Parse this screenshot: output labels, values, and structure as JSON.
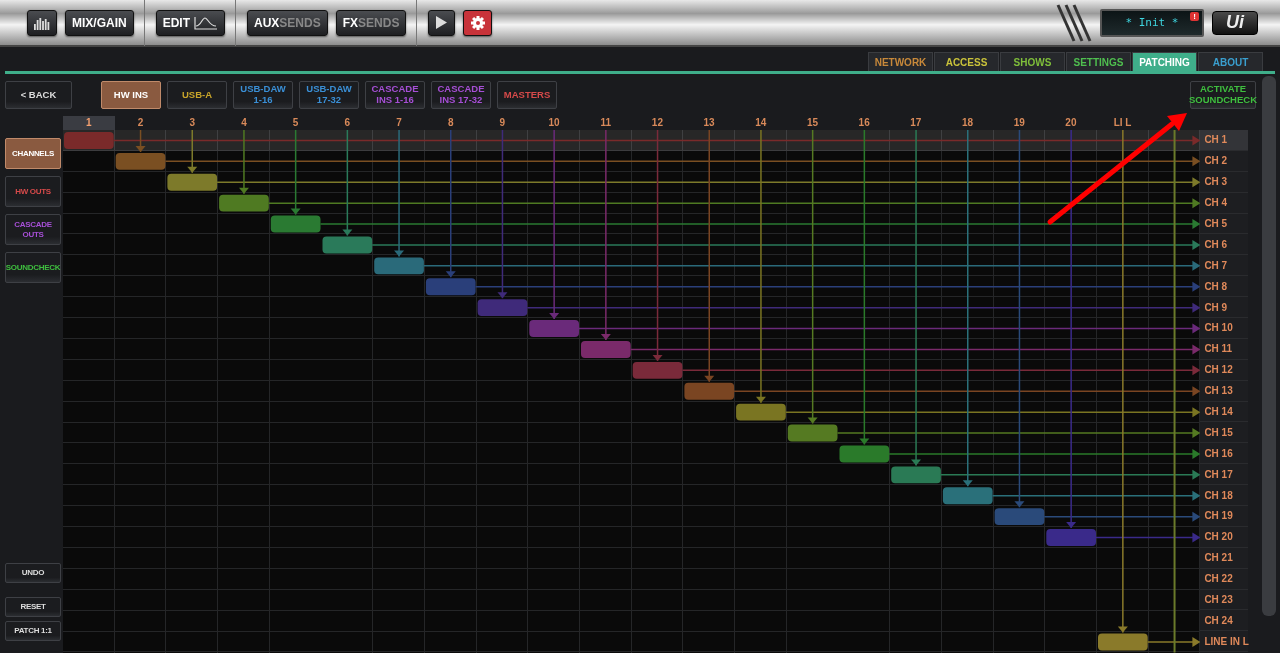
{
  "toolbar": {
    "buttons": [
      {
        "kind": "meter-icon"
      },
      {
        "kind": "text",
        "main": "MIX/GAIN"
      },
      {
        "kind": "edit",
        "main": "EDIT"
      },
      {
        "kind": "split",
        "main": "AUX",
        "dim": "SENDS"
      },
      {
        "kind": "split",
        "main": "FX",
        "dim": "SENDS"
      },
      {
        "kind": "play"
      },
      {
        "kind": "gear",
        "selected": true
      }
    ],
    "display": {
      "text": "* Init *",
      "alert": "!"
    },
    "logo": "Ui"
  },
  "settings_tabs": [
    {
      "label": "NETWORK",
      "color": "#c8893a",
      "selected": false
    },
    {
      "label": "ACCESS",
      "color": "#c9c23a",
      "selected": false
    },
    {
      "label": "SHOWS",
      "color": "#7fbf3a",
      "selected": false
    },
    {
      "label": "SETTINGS",
      "color": "#4fbf4f",
      "selected": false
    },
    {
      "label": "PATCHING",
      "color": "#3fae8a",
      "selected": true
    },
    {
      "label": "ABOUT",
      "color": "#3a9fcf",
      "selected": false
    }
  ],
  "back_button": "< BACK",
  "source_tabs": [
    {
      "label": "HW INS",
      "color": "#8a5a40",
      "selected": true
    },
    {
      "label": "USB-A",
      "color": "#c9a52a",
      "selected": false
    },
    {
      "label": "USB-DAW 1-16",
      "color": "#3a8fd6",
      "selected": false
    },
    {
      "label": "USB-DAW 17-32",
      "color": "#3a8fd6",
      "selected": false
    },
    {
      "label": "CASCADE INS 1-16",
      "color": "#a64fd6",
      "selected": false
    },
    {
      "label": "CASCADE INS 17-32",
      "color": "#a64fd6",
      "selected": false
    },
    {
      "label": "MASTERS",
      "color": "#d64a4a",
      "selected": false
    }
  ],
  "activate_button": "ACTIVATE SOUNDCHECK",
  "destination_tabs": [
    {
      "label": "CHANNELS",
      "color": "#8a5a40",
      "selected": true
    },
    {
      "label": "HW OUTS",
      "color": "#d64a4a",
      "selected": false
    },
    {
      "label": "CASCADE OUTS",
      "color": "#a64fd6",
      "selected": false
    },
    {
      "label": "SOUNDCHECK",
      "color": "#3fbf3f",
      "selected": false
    }
  ],
  "actions": [
    "UNDO",
    "RESET",
    "PATCH 1:1"
  ],
  "columns": [
    {
      "label": "1",
      "color": "#7a2a2a",
      "selected": true
    },
    {
      "label": "2",
      "color": "#7a4f22",
      "selected": false
    },
    {
      "label": "3",
      "color": "#7d7a2a",
      "selected": false
    },
    {
      "label": "4",
      "color": "#4f7a22",
      "selected": false
    },
    {
      "label": "5",
      "color": "#2a7a32",
      "selected": false
    },
    {
      "label": "6",
      "color": "#2a7a5a",
      "selected": false
    },
    {
      "label": "7",
      "color": "#2a6a7a",
      "selected": false
    },
    {
      "label": "8",
      "color": "#2a3f7a",
      "selected": false
    },
    {
      "label": "9",
      "color": "#3f2a7a",
      "selected": false
    },
    {
      "label": "10",
      "color": "#6a2a7a",
      "selected": false
    },
    {
      "label": "11",
      "color": "#7a2a6a",
      "selected": false
    },
    {
      "label": "12",
      "color": "#7a2a3a",
      "selected": false
    },
    {
      "label": "13",
      "color": "#7a4522",
      "selected": false
    },
    {
      "label": "14",
      "color": "#7a7522",
      "selected": false
    },
    {
      "label": "15",
      "color": "#557a22",
      "selected": false
    },
    {
      "label": "16",
      "color": "#2a7a2a",
      "selected": false
    },
    {
      "label": "17",
      "color": "#2a7a55",
      "selected": false
    },
    {
      "label": "18",
      "color": "#2a707a",
      "selected": false
    },
    {
      "label": "19",
      "color": "#2a4a7a",
      "selected": false
    },
    {
      "label": "20",
      "color": "#3a2a8a",
      "selected": false
    },
    {
      "label": "LI L",
      "color": "#8a7a2a",
      "selected": false
    },
    {
      "color": "#6a7a2a"
    }
  ],
  "rows": [
    {
      "label": "CH 1",
      "selected": true,
      "patched": true
    },
    {
      "label": "CH 2",
      "selected": false,
      "patched": true
    },
    {
      "label": "CH 3",
      "selected": false,
      "patched": true
    },
    {
      "label": "CH 4",
      "selected": false,
      "patched": true
    },
    {
      "label": "CH 5",
      "selected": false,
      "patched": true
    },
    {
      "label": "CH 6",
      "selected": false,
      "patched": true
    },
    {
      "label": "CH 7",
      "selected": false,
      "patched": true
    },
    {
      "label": "CH 8",
      "selected": false,
      "patched": true
    },
    {
      "label": "CH 9",
      "selected": false,
      "patched": true
    },
    {
      "label": "CH 10",
      "selected": false,
      "patched": true
    },
    {
      "label": "CH 11",
      "selected": false,
      "patched": true
    },
    {
      "label": "CH 12",
      "selected": false,
      "patched": true
    },
    {
      "label": "CH 13",
      "selected": false,
      "patched": true
    },
    {
      "label": "CH 14",
      "selected": false,
      "patched": true
    },
    {
      "label": "CH 15",
      "selected": false,
      "patched": true
    },
    {
      "label": "CH 16",
      "selected": false,
      "patched": true
    },
    {
      "label": "CH 17",
      "selected": false,
      "patched": true
    },
    {
      "label": "CH 18",
      "selected": false,
      "patched": true
    },
    {
      "label": "CH 19",
      "selected": false,
      "patched": true
    },
    {
      "label": "CH 20",
      "selected": false,
      "patched": true
    },
    {
      "label": "CH 21",
      "selected": false,
      "patched": false
    },
    {
      "label": "CH 22",
      "selected": false,
      "patched": false
    },
    {
      "label": "CH 23",
      "selected": false,
      "patched": false
    },
    {
      "label": "CH 24",
      "selected": false,
      "patched": false
    },
    {
      "label": "LINE IN L",
      "selected": false,
      "patched": true
    }
  ],
  "annotation": {
    "kind": "arrow"
  }
}
